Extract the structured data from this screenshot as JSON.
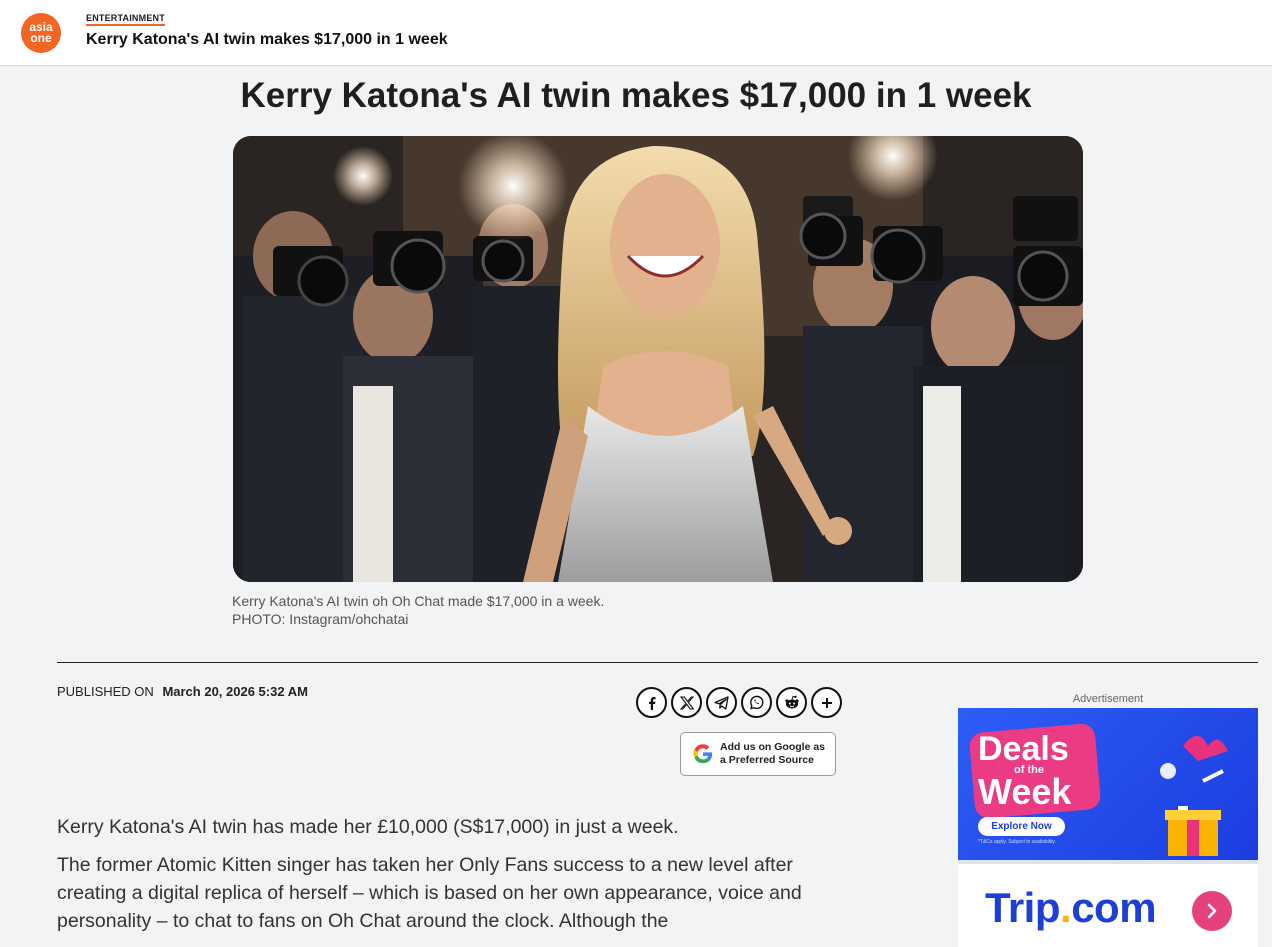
{
  "header": {
    "logo_top": "asia",
    "logo_bottom": "one",
    "section": "ENTERTAINMENT",
    "title": "Kerry Katona's AI twin makes $17,000 in 1 week"
  },
  "article": {
    "headline": "Kerry Katona's AI twin makes $17,000 in 1 week",
    "caption_line1": "Kerry Katona's AI twin oh Oh Chat made $17,000 in a week.",
    "caption_line2": "PHOTO: Instagram/ohchatai",
    "published_label": "PUBLISHED ON",
    "published_date": "March 20, 2026 5:32 AM",
    "paragraphs": [
      "Kerry Katona's AI twin has made her £10,000 (S$17,000) in just a week.",
      "The former Atomic Kitten singer has taken her Only Fans success to a new level after creating a digital replica of herself – which is based on her own appearance, voice and personality – to chat to fans on Oh Chat around the clock. Although the"
    ]
  },
  "share": {
    "buttons": [
      "facebook-icon",
      "x-icon",
      "telegram-icon",
      "whatsapp-icon",
      "reddit-icon",
      "plus-icon"
    ],
    "google_line1": "Add us on Google as",
    "google_line2": "a Preferred Source"
  },
  "ad": {
    "label": "Advertisement",
    "deals_line1": "Deals",
    "deals_line2": "of the",
    "deals_line3": "Week",
    "cta": "Explore Now",
    "terms": "*T&Cs apply. Subject to availability.",
    "brand_main": "Trip",
    "brand_dot": ".",
    "brand_tld": "com",
    "colors": {
      "blue": "#1d3fd8",
      "pink": "#ec3b85",
      "gold": "#f8b400"
    }
  },
  "colors": {
    "accent": "#f26522",
    "background": "#f2f3f5"
  }
}
